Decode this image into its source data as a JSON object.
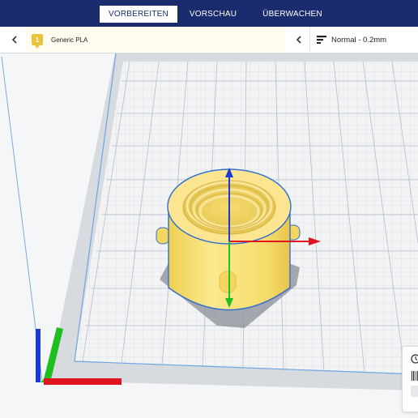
{
  "header": {
    "tabs": [
      {
        "label": "VORBEREITEN",
        "active": true
      },
      {
        "label": "VORSCHAU",
        "active": false
      },
      {
        "label": "ÜBERWACHEN",
        "active": false
      }
    ]
  },
  "toolbar": {
    "material": {
      "badge": "1",
      "label": "Generic PLA"
    },
    "profile": {
      "label": "Normal - 0.2mm"
    }
  },
  "colors": {
    "header_bg": "#1a2b6e",
    "material_badge": "#e9c43b",
    "model_fill": "#f9e27f",
    "model_outline": "#2f6fd0",
    "axis_x": "#e0141e",
    "axis_y": "#1fbf1f",
    "axis_z": "#1a3ad6"
  },
  "icons": {
    "back": "chevron-left-icon",
    "collapse": "chevron-left-icon",
    "profile": "print-settings-icon",
    "time": "clock-icon",
    "layers": "barcode-icon"
  }
}
